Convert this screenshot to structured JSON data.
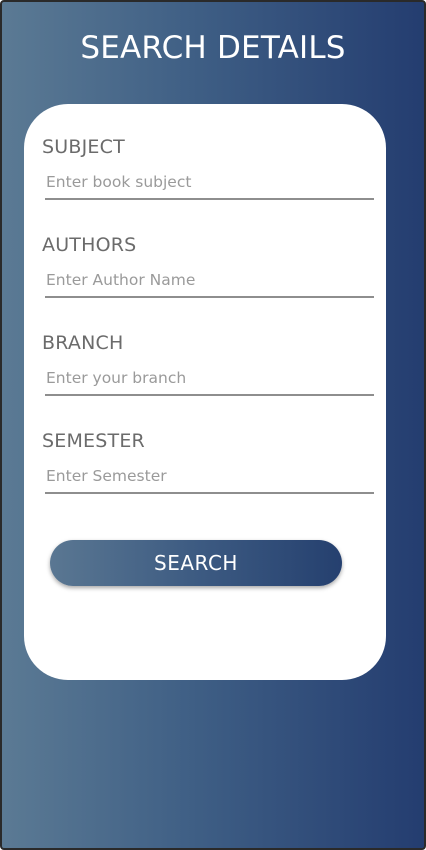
{
  "header": {
    "title": "SEARCH DETAILS"
  },
  "form": {
    "fields": [
      {
        "label": "SUBJECT",
        "placeholder": "Enter book subject",
        "value": ""
      },
      {
        "label": "AUTHORS",
        "placeholder": "Enter Author Name",
        "value": ""
      },
      {
        "label": "BRANCH",
        "placeholder": "Enter your branch",
        "value": ""
      },
      {
        "label": "SEMESTER",
        "placeholder": "Enter Semester",
        "value": ""
      }
    ],
    "search_label": "SEARCH"
  },
  "colors": {
    "gradient_start": "#5b7a94",
    "gradient_end": "#243d70",
    "card_background": "#ffffff"
  }
}
